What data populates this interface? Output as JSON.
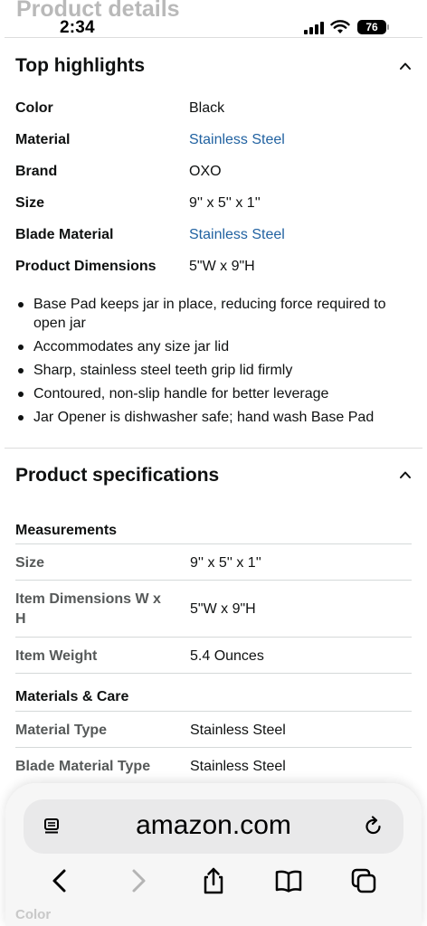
{
  "ghost_header": "Product details",
  "status": {
    "time": "2:34",
    "battery": "76"
  },
  "highlights": {
    "title": "Top highlights",
    "rows": [
      {
        "label": "Color",
        "value": "Black",
        "link": false
      },
      {
        "label": "Material",
        "value": "Stainless Steel",
        "link": true
      },
      {
        "label": "Brand",
        "value": "OXO",
        "link": false
      },
      {
        "label": "Size",
        "value": "9'' x 5'' x 1''",
        "link": false
      },
      {
        "label": "Blade Material",
        "value": "Stainless Steel",
        "link": true
      },
      {
        "label": "Product Dimensions",
        "value": "5\"W x 9\"H",
        "link": false
      }
    ],
    "bullets": [
      "Base Pad keeps jar in place, reducing force required to open jar",
      "Accommodates any size jar lid",
      "Sharp, stainless steel teeth grip lid firmly",
      "Contoured, non-slip handle for better leverage",
      "Jar Opener is dishwasher safe; hand wash Base Pad"
    ]
  },
  "specs": {
    "title": "Product specifications",
    "groups": [
      {
        "name": "Measurements",
        "rows": [
          {
            "label": "Size",
            "value": "9'' x 5'' x 1''"
          },
          {
            "label": "Item Dimensions W x H",
            "value": "5\"W x 9\"H"
          },
          {
            "label": "Item Weight",
            "value": "5.4 Ounces"
          }
        ]
      },
      {
        "name": "Materials & Care",
        "rows": [
          {
            "label": "Material Type",
            "value": "Stainless Steel"
          },
          {
            "label": "Blade Material Type",
            "value": "Stainless Steel"
          }
        ]
      }
    ]
  },
  "faded_below": {
    "label": "Color"
  },
  "browser": {
    "url": "amazon.com",
    "toolbar": [
      "back-icon",
      "forward-icon",
      "share-icon",
      "bookmarks-icon",
      "tabs-icon"
    ]
  }
}
